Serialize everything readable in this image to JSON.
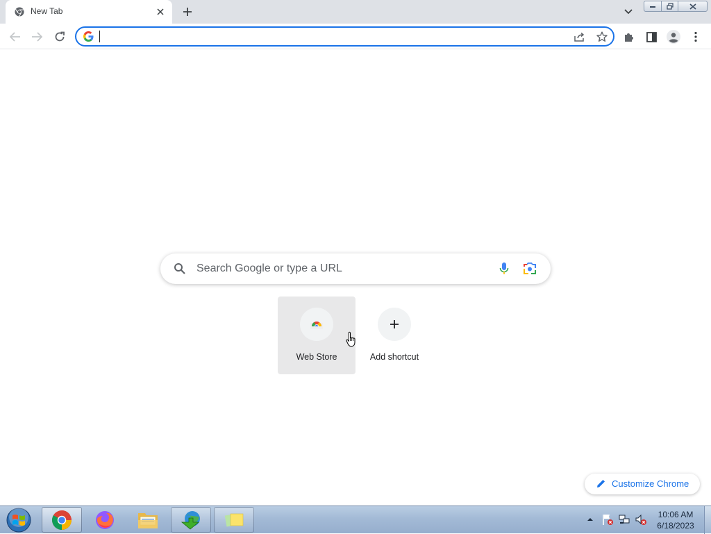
{
  "browser": {
    "tab": {
      "title": "New Tab",
      "close_icon": "close-icon",
      "favicon": "chrome-icon"
    },
    "new_tab_icon": "plus-icon",
    "tab_search_icon": "chevron-down-icon",
    "window_controls": [
      "minimize-icon",
      "restore-icon",
      "close-icon"
    ],
    "toolbar": {
      "back_icon": "arrow-left-icon",
      "forward_icon": "arrow-right-icon",
      "reload_icon": "reload-icon",
      "omnibox": {
        "value": "",
        "placeholder": "",
        "google_icon": "google-g-icon",
        "share_icon": "share-icon",
        "bookmark_icon": "star-icon"
      },
      "extensions_icon": "puzzle-icon",
      "side_panel_icon": "side-panel-icon",
      "profile_icon": "profile-icon",
      "menu_icon": "kebab-menu-icon"
    }
  },
  "ntp": {
    "search": {
      "placeholder": "Search Google or type a URL",
      "icons": [
        "search-icon",
        "microphone-icon",
        "lens-camera-icon"
      ]
    },
    "shortcuts": [
      {
        "label": "Web Store",
        "icon": "chrome-web-store-icon",
        "hovered": true
      },
      {
        "label": "Add shortcut",
        "icon": "plus-icon",
        "hovered": false
      }
    ],
    "customize": {
      "label": "Customize Chrome",
      "icon": "pencil-icon"
    }
  },
  "taskbar": {
    "start_icon": "windows-start-icon",
    "apps": [
      {
        "name": "chrome-icon",
        "state": "active"
      },
      {
        "name": "firefox-icon",
        "state": "pinned"
      },
      {
        "name": "file-explorer-icon",
        "state": "pinned"
      },
      {
        "name": "internet-download-manager-icon",
        "state": "running"
      },
      {
        "name": "sticky-notes-icon",
        "state": "running"
      }
    ],
    "tray": [
      "show-hidden-icons-arrow",
      "action-center-flag-icon",
      "network-icon",
      "volume-muted-icon"
    ],
    "clock": {
      "time": "10:06 AM",
      "date": "6/18/2023"
    }
  },
  "colors": {
    "accent": "#1a73e8",
    "tab_strip": "#dee1e6",
    "taskbar": "#a3bad6"
  }
}
